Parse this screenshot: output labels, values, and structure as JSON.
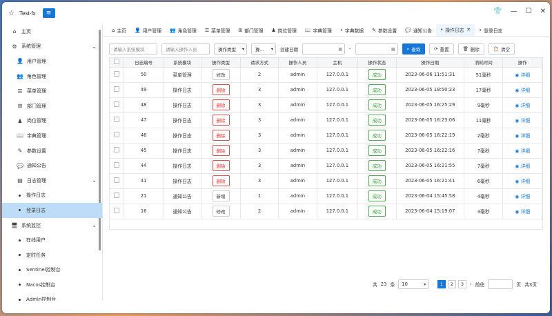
{
  "window": {
    "title": "Test-fx"
  },
  "colors": {
    "accent": "#1677d7",
    "danger": "#e03030",
    "success": "#2d9a2d",
    "active_bg": "#bcdcf7"
  },
  "sidebar": {
    "items": [
      {
        "label": "主页",
        "icon": "home-icon",
        "level": 1
      },
      {
        "label": "系统管理",
        "icon": "gear-icon",
        "level": 1,
        "expanded": true
      },
      {
        "label": "用户管理",
        "icon": "user-icon",
        "level": 2
      },
      {
        "label": "角色管理",
        "icon": "users-icon",
        "level": 2
      },
      {
        "label": "菜单管理",
        "icon": "menu-list-icon",
        "level": 2
      },
      {
        "label": "部门管理",
        "icon": "org-icon",
        "level": 2
      },
      {
        "label": "岗位管理",
        "icon": "post-icon",
        "level": 2
      },
      {
        "label": "字典管理",
        "icon": "book-icon",
        "level": 2
      },
      {
        "label": "参数设置",
        "icon": "edit-icon",
        "level": 2
      },
      {
        "label": "通知公告",
        "icon": "chat-icon",
        "level": 2
      },
      {
        "label": "日志管理",
        "icon": "log-icon",
        "level": 2,
        "expanded": true
      },
      {
        "label": "操作日志",
        "icon": "dot-icon",
        "level": 3
      },
      {
        "label": "登录日志",
        "icon": "dot-icon",
        "level": 3,
        "active": true
      },
      {
        "label": "系统监控",
        "icon": "monitor-icon",
        "level": 1,
        "expanded": true
      },
      {
        "label": "在线用户",
        "icon": "dot-icon",
        "level": 3
      },
      {
        "label": "定时任务",
        "icon": "dot-icon",
        "level": 3
      },
      {
        "label": "Sentinel控制台",
        "icon": "dot-icon",
        "level": 3
      },
      {
        "label": "Nacos控制台",
        "icon": "dot-icon",
        "level": 3
      },
      {
        "label": "Admin控制台",
        "icon": "dot-icon",
        "level": 3
      }
    ]
  },
  "tabs": [
    {
      "label": "主页",
      "icon": "home-icon"
    },
    {
      "label": "用户管理",
      "icon": "user-icon"
    },
    {
      "label": "角色管理",
      "icon": "users-icon"
    },
    {
      "label": "菜单管理",
      "icon": "menu-list-icon"
    },
    {
      "label": "部门管理",
      "icon": "org-icon"
    },
    {
      "label": "岗位管理",
      "icon": "post-icon"
    },
    {
      "label": "字典管理",
      "icon": "book-icon"
    },
    {
      "label": "字典数据",
      "icon": "dot-icon"
    },
    {
      "label": "参数设置",
      "icon": "edit-icon"
    },
    {
      "label": "通知公告",
      "icon": "chat-icon"
    },
    {
      "label": "操作日志",
      "icon": "dot-icon",
      "active": true,
      "closable": true
    },
    {
      "label": "登录日志",
      "icon": "dot-icon"
    }
  ],
  "filters": {
    "module_placeholder": "请输入系统模块",
    "operator_placeholder": "请输入操作人员",
    "type_select": "操作类型",
    "status_select": "操...",
    "date_label": "创建日期",
    "date_sep": "-",
    "search": "查询",
    "reset": "重置",
    "delete": "删除",
    "clear": "清空"
  },
  "table": {
    "headers": [
      "日志编号",
      "系统模块",
      "操作类型",
      "请求方式",
      "操作人员",
      "主机",
      "操作状态",
      "操作日期",
      "消耗时间",
      "操作"
    ],
    "rows": [
      {
        "id": "50",
        "module": "菜单管理",
        "type": "修改",
        "type_style": "plain",
        "method": "2",
        "user": "admin",
        "host": "127.0.0.1",
        "status": "成功",
        "date": "2023-06-06 11:51:31",
        "time": "51毫秒",
        "action": "详细"
      },
      {
        "id": "49",
        "module": "操作日志",
        "type": "删除",
        "type_style": "red",
        "method": "3",
        "user": "admin",
        "host": "127.0.0.1",
        "status": "成功",
        "date": "2023-06-05 18:50:23",
        "time": "17毫秒",
        "action": "详细"
      },
      {
        "id": "48",
        "module": "操作日志",
        "type": "删除",
        "type_style": "red",
        "method": "3",
        "user": "admin",
        "host": "127.0.0.1",
        "status": "成功",
        "date": "2023-06-05 16:25:29",
        "time": "9毫秒",
        "action": "详细"
      },
      {
        "id": "47",
        "module": "操作日志",
        "type": "删除",
        "type_style": "red",
        "method": "3",
        "user": "admin",
        "host": "127.0.0.1",
        "status": "成功",
        "date": "2023-06-05 16:23:06",
        "time": "11毫秒",
        "action": "详细"
      },
      {
        "id": "46",
        "module": "操作日志",
        "type": "删除",
        "type_style": "red",
        "method": "3",
        "user": "admin",
        "host": "127.0.0.1",
        "status": "成功",
        "date": "2023-06-05 16:22:19",
        "time": "2毫秒",
        "action": "详细"
      },
      {
        "id": "45",
        "module": "操作日志",
        "type": "删除",
        "type_style": "red",
        "method": "3",
        "user": "admin",
        "host": "127.0.0.1",
        "status": "成功",
        "date": "2023-06-05 16:22:16",
        "time": "7毫秒",
        "action": "详细"
      },
      {
        "id": "44",
        "module": "操作日志",
        "type": "删除",
        "type_style": "red",
        "method": "3",
        "user": "admin",
        "host": "127.0.0.1",
        "status": "成功",
        "date": "2023-06-05 16:21:55",
        "time": "7毫秒",
        "action": "详细"
      },
      {
        "id": "41",
        "module": "操作日志",
        "type": "删除",
        "type_style": "red",
        "method": "3",
        "user": "admin",
        "host": "127.0.0.1",
        "status": "成功",
        "date": "2023-06-05 16:21:41",
        "time": "6毫秒",
        "action": "详细"
      },
      {
        "id": "21",
        "module": "通知公告",
        "type": "新增",
        "type_style": "plain",
        "method": "1",
        "user": "admin",
        "host": "127.0.0.1",
        "status": "成功",
        "date": "2023-06-04 15:45:58",
        "time": "4毫秒",
        "action": "详细"
      },
      {
        "id": "16",
        "module": "通知公告",
        "type": "修改",
        "type_style": "plain",
        "method": "2",
        "user": "admin",
        "host": "127.0.0.1",
        "status": "成功",
        "date": "2023-06-04 15:19:07",
        "time": "3毫秒",
        "action": "详细"
      }
    ]
  },
  "pager": {
    "total_prefix": "共",
    "total": "23",
    "total_suffix": "条",
    "page_size": "10",
    "pages": [
      "1",
      "2",
      "3"
    ],
    "current": "1",
    "goto_label": "前往",
    "page_suffix": "页",
    "page_count": "共3页"
  }
}
